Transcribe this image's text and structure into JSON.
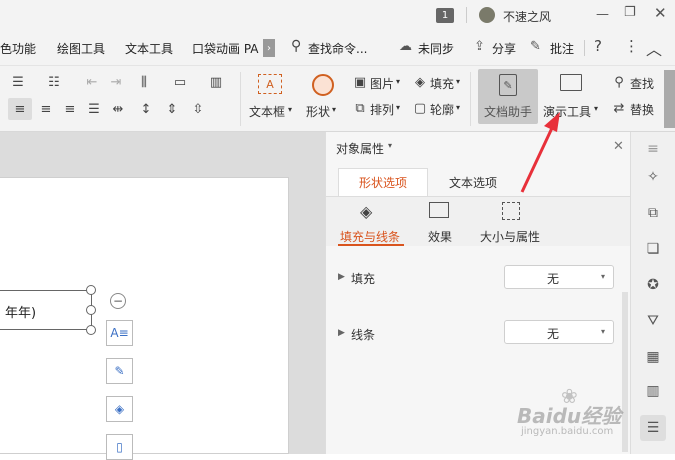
{
  "titlebar": {
    "page_badge": "1",
    "username": "不速之风"
  },
  "menubar": {
    "items": [
      "特色功能",
      "绘图工具",
      "文本工具",
      "口袋动画 PA"
    ],
    "search_placeholder": "查找命令...",
    "sync": "未同步",
    "share": "分享",
    "comment": "批注"
  },
  "ribbon": {
    "textbox": "文本框",
    "shape": "形状",
    "picture": "图片",
    "arrange": "排列",
    "fill": "填充",
    "outline": "轮廓",
    "doc_assistant": "文档助手",
    "present_tools": "演示工具",
    "find": "查找",
    "replace": "替换"
  },
  "slide": {
    "textbox_text": "年年)"
  },
  "panel": {
    "title": "对象属性",
    "tabs": [
      "形状选项",
      "文本选项"
    ],
    "subtabs": [
      "填充与线条",
      "效果",
      "大小与属性"
    ],
    "rows": [
      {
        "label": "填充",
        "value": "无"
      },
      {
        "label": "线条",
        "value": "无"
      }
    ]
  },
  "watermark": {
    "brand": "Baidu经验",
    "url": "jingyan.baidu.com"
  },
  "colors": {
    "accent": "#d9541e",
    "arrow": "#e8303a"
  }
}
